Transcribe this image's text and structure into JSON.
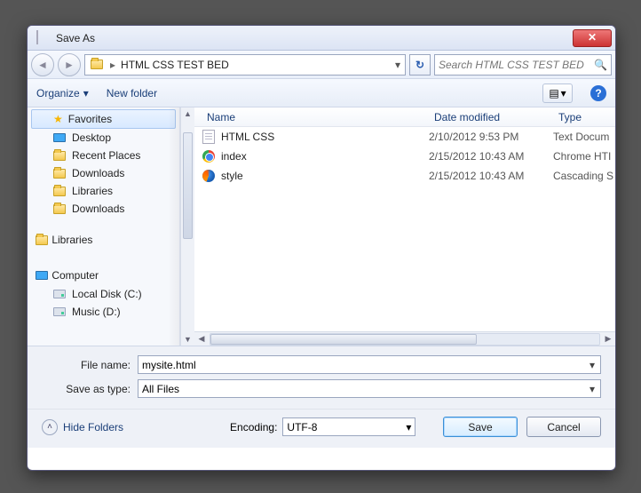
{
  "window": {
    "title": "Save As"
  },
  "nav": {
    "breadcrumb": "HTML CSS TEST BED",
    "search_placeholder": "Search HTML CSS TEST BED"
  },
  "toolbar": {
    "organize": "Organize",
    "newfolder": "New folder"
  },
  "sidebar": {
    "favorites": {
      "label": "Favorites",
      "items": [
        {
          "label": "Desktop",
          "icon": "monitor"
        },
        {
          "label": "Recent Places",
          "icon": "folder"
        },
        {
          "label": "Downloads",
          "icon": "folder"
        },
        {
          "label": "Libraries",
          "icon": "folder"
        },
        {
          "label": "Downloads",
          "icon": "folder"
        }
      ]
    },
    "libraries": {
      "label": "Libraries"
    },
    "computer": {
      "label": "Computer",
      "items": [
        {
          "label": "Local Disk (C:)",
          "icon": "drive"
        },
        {
          "label": "Music (D:)",
          "icon": "drive"
        }
      ]
    }
  },
  "columns": {
    "name": "Name",
    "date": "Date modified",
    "type": "Type"
  },
  "files": [
    {
      "name": "HTML CSS",
      "date": "2/10/2012 9:53 PM",
      "type": "Text Docum",
      "icon": "page"
    },
    {
      "name": "index",
      "date": "2/15/2012 10:43 AM",
      "type": "Chrome HTI",
      "icon": "chrome"
    },
    {
      "name": "style",
      "date": "2/15/2012 10:43 AM",
      "type": "Cascading S",
      "icon": "ff"
    }
  ],
  "form": {
    "filename_label": "File name:",
    "filename_value": "mysite.html",
    "saveastype_label": "Save as type:",
    "saveastype_value": "All Files"
  },
  "footer": {
    "hidefolders": "Hide Folders",
    "encoding_label": "Encoding:",
    "encoding_value": "UTF-8",
    "save": "Save",
    "cancel": "Cancel"
  }
}
